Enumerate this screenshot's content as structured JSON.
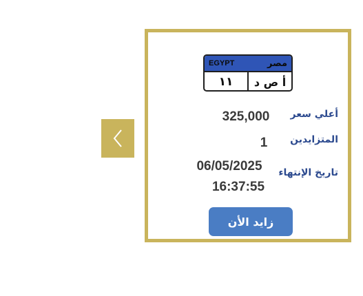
{
  "navigation": {
    "prev_icon": "chevron-left-icon"
  },
  "plate": {
    "country_en": "EGYPT",
    "country_ar": "مصر",
    "numbers": "١١",
    "letters": "أ ص د"
  },
  "auction": {
    "highest_price_label": "أعلي سعر",
    "highest_price_value": "325,000",
    "bidders_label": "المتزايدين",
    "bidders_value": "1",
    "end_date_label": "تاريخ الإنتهاء",
    "end_date": "06/05/2025",
    "end_time": "16:37:55",
    "bid_button_label": "زايد الأن"
  },
  "colors": {
    "gold": "#c9b45c",
    "label_blue": "#2c4a8f",
    "button_blue": "#4a7dc4",
    "plate_blue": "#2f55b6"
  }
}
